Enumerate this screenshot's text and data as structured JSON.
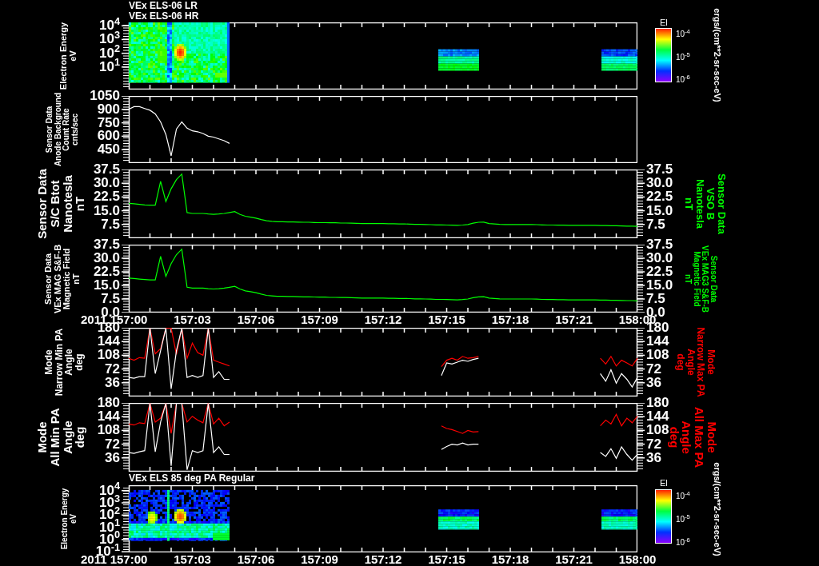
{
  "titles": [
    "VEx ELS-06 LR",
    "VEx ELS-06 HR"
  ],
  "panels": [
    {
      "kind": "spectrogram",
      "y_label": [
        "Electron Energy",
        "eV"
      ],
      "yticks": [
        "10$^{4}$",
        "10$^{3}$",
        "10$^{2}$",
        "10$^{1}$"
      ],
      "colorbar": {
        "label": "El",
        "ticks": [
          "10$^{-4}$",
          "10$^{-5}$",
          "10$^{-6}$"
        ],
        "units": "ergs/(cm**2-sr-sec-eV)"
      }
    },
    {
      "kind": "line",
      "y_label": [
        "Sensor Data",
        "Anode Background",
        "Count Rate",
        "cnts/sec"
      ],
      "chart_data": {
        "type": "line",
        "categories": [
          null,
          null,
          null,
          null,
          null,
          null,
          null,
          null,
          null,
          null,
          null,
          null,
          null,
          null,
          null,
          null,
          null,
          null,
          null,
          null
        ],
        "series": [
          {
            "color": "#ffffff",
            "values": [
              900,
              930,
              930,
              910,
              890,
              850,
              760,
              620,
              380,
              680,
              760,
              690,
              660,
              650,
              630,
              600,
              590,
              570,
              550,
              520
            ]
          }
        ],
        "ylim": [
          300,
          1050
        ],
        "yticks": [
          {
            "value": 450,
            "label": "450"
          },
          {
            "value": 600,
            "label": "600"
          },
          {
            "value": 750,
            "label": "750"
          },
          {
            "value": 900,
            "label": "900"
          },
          {
            "value": 1050,
            "label": "1050"
          }
        ]
      }
    },
    {
      "kind": "line",
      "y_label": [
        "Sensor Data",
        "S/C Btot",
        "Nanotesla",
        "nT"
      ],
      "right_axis": {
        "ticks": [
          "37.5",
          "30.0",
          "22.5",
          "15.0",
          "7.5"
        ],
        "label": [
          "Sensor Data",
          "VSO B",
          "Nanotesla",
          "nT"
        ]
      },
      "chart_data": {
        "type": "line",
        "categories": [
          null,
          null,
          null,
          null,
          null,
          null,
          null,
          null,
          null,
          null,
          null,
          null,
          null,
          null,
          null,
          null,
          null,
          null,
          null,
          null,
          null,
          null,
          null,
          null,
          null,
          null,
          null,
          null,
          null,
          null,
          null,
          null,
          null,
          null,
          null,
          null,
          null,
          null,
          null,
          null,
          null,
          null,
          null,
          null,
          null,
          null,
          null,
          null,
          null,
          null,
          null,
          null,
          null,
          null,
          null,
          null,
          null,
          null,
          null,
          null,
          null,
          null,
          null,
          null,
          null,
          null,
          null,
          null,
          null,
          null,
          null,
          null,
          null,
          null,
          null,
          null,
          null,
          null,
          null,
          null,
          null,
          null,
          null,
          null,
          null,
          null,
          null,
          null,
          null,
          null,
          null,
          null,
          null,
          null,
          null,
          null,
          null
        ],
        "series": [
          {
            "color": "#00ff00",
            "values": [
              19,
              18.8,
              18.5,
              18.2,
              18,
              18,
              31,
              20,
              27,
              32,
              35,
              14,
              13.5,
              13.5,
              13.5,
              13.2,
              13,
              13.2,
              13.5,
              14,
              14.5,
              13,
              12,
              11.5,
              11,
              10.2,
              9.5,
              9.2,
              9,
              9,
              8.9,
              8.9,
              8.8,
              8.7,
              8.7,
              8.6,
              8.5,
              8.5,
              8.4,
              8.4,
              8.3,
              8.3,
              8.2,
              8.1,
              8,
              8,
              8,
              8,
              8,
              7.9,
              7.9,
              7.8,
              7.8,
              7.7,
              7.6,
              7.6,
              7.5,
              7.4,
              7.3,
              7.3,
              7.2,
              7.1,
              7,
              7.2,
              7.5,
              8.2,
              8.7,
              8.8,
              8,
              7.8,
              7.6,
              7.5,
              7.5,
              7.5,
              7.5,
              7.5,
              7.5,
              7.4,
              7.3,
              7.2,
              7.2,
              7.1,
              7.1,
              7,
              7,
              7,
              7,
              7,
              7,
              6.9,
              6.9,
              6.8,
              6.8,
              6.7,
              6.6,
              6.6,
              6.5
            ]
          }
        ],
        "ylim": [
          0,
          37.5
        ],
        "yticks": [
          {
            "value": 7.5,
            "label": "7.5"
          },
          {
            "value": 15,
            "label": "15.0"
          },
          {
            "value": 22.5,
            "label": "22.5"
          },
          {
            "value": 30,
            "label": "30.0"
          },
          {
            "value": 37.5,
            "label": "37.5"
          }
        ]
      }
    },
    {
      "kind": "line",
      "y_label": [
        "Sensor Data",
        "VEx MAG S&F-B",
        "Magnetic Field",
        "nT"
      ],
      "right_axis": {
        "ticks": [
          "37.5",
          "30.0",
          "22.5",
          "15.0",
          "7.5",
          "0.0"
        ],
        "label": [
          "Sensor Data",
          "VEx MAG3 S&F-B",
          "Magnetic Field",
          "nT"
        ]
      },
      "x_axis": {
        "year": "2011",
        "labels": [
          "157:00",
          "157:03",
          "157:06",
          "157:09",
          "157:12",
          "157:15",
          "157:18",
          "157:21",
          "158:00"
        ]
      },
      "chart_data": {
        "type": "line",
        "categories": [
          null,
          null,
          null,
          null,
          null,
          null,
          null,
          null,
          null,
          null,
          null,
          null,
          null,
          null,
          null,
          null,
          null,
          null,
          null,
          null,
          null,
          null,
          null,
          null,
          null,
          null,
          null,
          null,
          null,
          null,
          null,
          null,
          null,
          null,
          null,
          null,
          null,
          null,
          null,
          null,
          null,
          null,
          null,
          null,
          null,
          null,
          null,
          null,
          null,
          null,
          null,
          null,
          null,
          null,
          null,
          null,
          null,
          null,
          null,
          null,
          null,
          null,
          null,
          null,
          null,
          null,
          null,
          null,
          null,
          null,
          null,
          null,
          null,
          null,
          null,
          null,
          null,
          null,
          null,
          null,
          null,
          null,
          null,
          null,
          null,
          null,
          null,
          null,
          null,
          null,
          null,
          null,
          null,
          null,
          null,
          null,
          null
        ],
        "series": [
          {
            "color": "#00ff00",
            "values": [
              19,
              18.8,
              18.5,
              18.2,
              18,
              18,
              31,
              20,
              27,
              32,
              35,
              14,
              13.5,
              13.5,
              13.5,
              13.2,
              13,
              13.2,
              13.5,
              14,
              14.5,
              13,
              12,
              11.5,
              11,
              10.2,
              9.5,
              9.2,
              9,
              9,
              8.9,
              8.9,
              8.8,
              8.7,
              8.7,
              8.6,
              8.5,
              8.5,
              8.4,
              8.4,
              8.3,
              8.3,
              8.2,
              8.1,
              8,
              8,
              8,
              8,
              8,
              7.9,
              7.9,
              7.8,
              7.8,
              7.7,
              7.6,
              7.6,
              7.5,
              7.4,
              7.3,
              7.3,
              7.2,
              7.1,
              7,
              7.2,
              7.5,
              8.2,
              8.7,
              8.8,
              8,
              7.8,
              7.6,
              7.5,
              7.5,
              7.5,
              7.5,
              7.5,
              7.5,
              7.4,
              7.3,
              7.2,
              7.2,
              7.1,
              7.1,
              7,
              7,
              7,
              7,
              7,
              7,
              6.9,
              6.9,
              6.8,
              6.8,
              6.7,
              6.6,
              6.6,
              6.5
            ]
          }
        ],
        "ylim": [
          0,
          37.5
        ],
        "yticks": [
          {
            "value": 0,
            "label": "0.0"
          },
          {
            "value": 7.5,
            "label": "7.5"
          },
          {
            "value": 15,
            "label": "15.0"
          },
          {
            "value": 22.5,
            "label": "22.5"
          },
          {
            "value": 30,
            "label": "30.0"
          },
          {
            "value": 37.5,
            "label": "37.5"
          }
        ]
      }
    },
    {
      "kind": "line",
      "y_label": [
        "Mode",
        "Narrow Min PA",
        "Angle",
        "deg"
      ],
      "right_axis": {
        "ticks": [
          "180",
          "144",
          "108",
          "72",
          "36"
        ],
        "label": [
          "Mode",
          "Narrow Max PA",
          "Angle",
          "deg"
        ]
      },
      "chart_data": {
        "type": "line",
        "categories": [
          null,
          null,
          null,
          null,
          null,
          null,
          null,
          null,
          null,
          null,
          null,
          null,
          null,
          null,
          null,
          null,
          null,
          null,
          null,
          null,
          null,
          null,
          null,
          null,
          null,
          null,
          null,
          null,
          null,
          null,
          null,
          null,
          null,
          null,
          null,
          null,
          null,
          null,
          null,
          null,
          null,
          null,
          null,
          null,
          null,
          null,
          null,
          null,
          null,
          null,
          null,
          null,
          null,
          null,
          null,
          null,
          null,
          null,
          null,
          null,
          null,
          null,
          null,
          null,
          null,
          null,
          null,
          null,
          null,
          null,
          null,
          null,
          null,
          null,
          null,
          null,
          null,
          null,
          null,
          null,
          null,
          null,
          null,
          null,
          null,
          null,
          null,
          null,
          null,
          null,
          null,
          null,
          null,
          null,
          null,
          null,
          null
        ],
        "series": [
          {
            "color": "#ff0000",
            "values": [
              100,
              95,
              102,
              100,
              180,
              112,
              125,
              180,
              180,
              110,
              180,
              100,
              140,
              115,
              108,
              180,
              95,
              90,
              85,
              80,
              null,
              null,
              null,
              null,
              null,
              null,
              null,
              null,
              null,
              null,
              null,
              null,
              null,
              null,
              null,
              null,
              null,
              null,
              null,
              null,
              null,
              null,
              null,
              null,
              null,
              null,
              null,
              null,
              null,
              null,
              null,
              null,
              null,
              null,
              null,
              null,
              null,
              null,
              null,
              78,
              95,
              100,
              95,
              105,
              100,
              102,
              105,
              null,
              null,
              null,
              null,
              null,
              null,
              null,
              null,
              null,
              null,
              null,
              null,
              null,
              null,
              null,
              null,
              null,
              null,
              null,
              null,
              null,
              null,
              100,
              85,
              105,
              80,
              95,
              88,
              80,
              100
            ]
          },
          {
            "color": "#ffffff",
            "values": [
              50,
              48,
              52,
              52,
              180,
              60,
              120,
              180,
              20,
              120,
              180,
              50,
              55,
              50,
              55,
              180,
              50,
              65,
              45,
              45,
              null,
              null,
              null,
              null,
              null,
              null,
              null,
              null,
              null,
              null,
              null,
              null,
              null,
              null,
              null,
              null,
              null,
              null,
              null,
              null,
              null,
              null,
              null,
              null,
              null,
              null,
              null,
              null,
              null,
              null,
              null,
              null,
              null,
              null,
              null,
              null,
              null,
              null,
              null,
              55,
              88,
              85,
              90,
              95,
              92,
              97,
              100,
              null,
              null,
              null,
              null,
              null,
              null,
              null,
              null,
              null,
              null,
              null,
              null,
              null,
              null,
              null,
              null,
              null,
              null,
              null,
              null,
              null,
              null,
              60,
              40,
              70,
              35,
              60,
              45,
              25,
              50
            ]
          }
        ],
        "ylim": [
          0,
          180
        ],
        "yticks": [
          {
            "value": 36,
            "label": "36"
          },
          {
            "value": 72,
            "label": "72"
          },
          {
            "value": 108,
            "label": "108"
          },
          {
            "value": 144,
            "label": "144"
          },
          {
            "value": 180,
            "label": "180"
          }
        ]
      }
    },
    {
      "kind": "line",
      "y_label": [
        "Mode",
        "All Min PA",
        "Angle",
        "deg"
      ],
      "right_axis": {
        "ticks": [
          "180",
          "144",
          "108",
          "72",
          "36"
        ],
        "label": [
          "Mode",
          "All Max PA",
          "Angle",
          "deg"
        ]
      },
      "chart_data": {
        "type": "line",
        "categories": [
          null,
          null,
          null,
          null,
          null,
          null,
          null,
          null,
          null,
          null,
          null,
          null,
          null,
          null,
          null,
          null,
          null,
          null,
          null,
          null,
          null,
          null,
          null,
          null,
          null,
          null,
          null,
          null,
          null,
          null,
          null,
          null,
          null,
          null,
          null,
          null,
          null,
          null,
          null,
          null,
          null,
          null,
          null,
          null,
          null,
          null,
          null,
          null,
          null,
          null,
          null,
          null,
          null,
          null,
          null,
          null,
          null,
          null,
          null,
          null,
          null,
          null,
          null,
          null,
          null,
          null,
          null,
          null,
          null,
          null,
          null,
          null,
          null,
          null,
          null,
          null,
          null,
          null,
          null,
          null,
          null,
          null,
          null,
          null,
          null,
          null,
          null,
          null,
          null,
          null,
          null,
          null,
          null,
          null,
          null,
          null,
          null
        ],
        "series": [
          {
            "color": "#ff0000",
            "values": [
              125,
              122,
              128,
              126,
              180,
              130,
              140,
              180,
              100,
              180,
              180,
              130,
              145,
              135,
              128,
              180,
              125,
              140,
              120,
              130,
              null,
              null,
              null,
              null,
              null,
              null,
              null,
              null,
              null,
              null,
              null,
              null,
              null,
              null,
              null,
              null,
              null,
              null,
              null,
              null,
              null,
              null,
              null,
              null,
              null,
              null,
              null,
              null,
              null,
              null,
              null,
              null,
              null,
              null,
              null,
              null,
              null,
              null,
              null,
              120,
              113,
              110,
              105,
              100,
              108,
              104,
              105,
              null,
              null,
              null,
              null,
              null,
              null,
              null,
              null,
              null,
              null,
              null,
              null,
              null,
              null,
              null,
              null,
              null,
              null,
              null,
              null,
              null,
              null,
              120,
              135,
              125,
              150,
              120,
              140,
              128,
              145
            ]
          },
          {
            "color": "#ffffff",
            "values": [
              50,
              48,
              52,
              55,
              180,
              52,
              130,
              180,
              15,
              180,
              180,
              5,
              55,
              50,
              55,
              180,
              50,
              65,
              45,
              45,
              null,
              null,
              null,
              null,
              null,
              null,
              null,
              null,
              null,
              null,
              null,
              null,
              null,
              null,
              null,
              null,
              null,
              null,
              null,
              null,
              null,
              null,
              null,
              null,
              null,
              null,
              null,
              null,
              null,
              null,
              null,
              null,
              null,
              null,
              null,
              null,
              null,
              null,
              null,
              58,
              66,
              72,
              70,
              75,
              70,
              72,
              72,
              null,
              null,
              null,
              null,
              null,
              null,
              null,
              null,
              null,
              null,
              null,
              null,
              null,
              null,
              null,
              null,
              null,
              null,
              null,
              null,
              null,
              null,
              50,
              40,
              60,
              35,
              65,
              45,
              30,
              45
            ]
          }
        ],
        "ylim": [
          0,
          180
        ],
        "yticks": [
          {
            "value": 36,
            "label": "36"
          },
          {
            "value": 72,
            "label": "72"
          },
          {
            "value": 108,
            "label": "108"
          },
          {
            "value": 144,
            "label": "144"
          },
          {
            "value": 180,
            "label": "180"
          }
        ]
      }
    },
    {
      "kind": "spectrogram",
      "title": "VEx ELS 85 deg PA Regular",
      "y_label": [
        "Electron Energy",
        "eV"
      ],
      "yticks": [
        "10$^{4}$",
        "10$^{3}$",
        "10$^{2}$",
        "10$^{1}$",
        "10$^{0}$",
        "10$^{-1}$"
      ],
      "colorbar": {
        "label": "El",
        "ticks": [
          "10$^{-4}$",
          "10$^{-5}$",
          "10$^{-6}$"
        ],
        "units": "ergs/(cm**2-sr-sec-eV)"
      },
      "x_axis": {
        "year": "2011",
        "labels": [
          "157:00",
          "157:03",
          "157:06",
          "157:09",
          "157:12",
          "157:15",
          "157:18",
          "157:21",
          "158:00"
        ]
      }
    }
  ]
}
